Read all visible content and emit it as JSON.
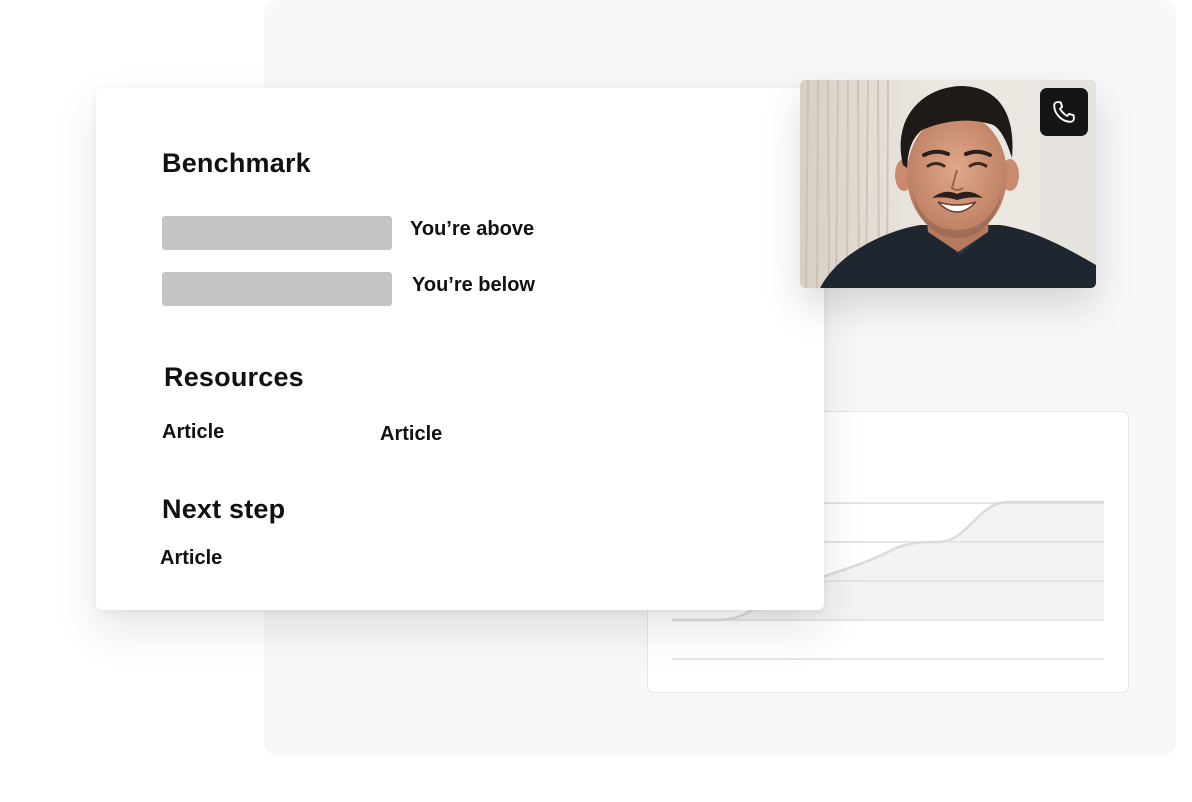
{
  "benchmark": {
    "title": "Benchmark",
    "above_label": "You’re above",
    "below_label": "You’re below"
  },
  "resources": {
    "title": "Resources",
    "articles": [
      "Article",
      "Article"
    ]
  },
  "next_step": {
    "title": "Next step",
    "article": "Article"
  },
  "video_call": {
    "participant_photo": "smiling-man-avatar",
    "call_icon": "phone-icon"
  },
  "colors": {
    "background_panel": "#f7f8f9",
    "placeholder_bar": "#c4c4c4",
    "call_button": "#151515",
    "text": "#111111"
  }
}
